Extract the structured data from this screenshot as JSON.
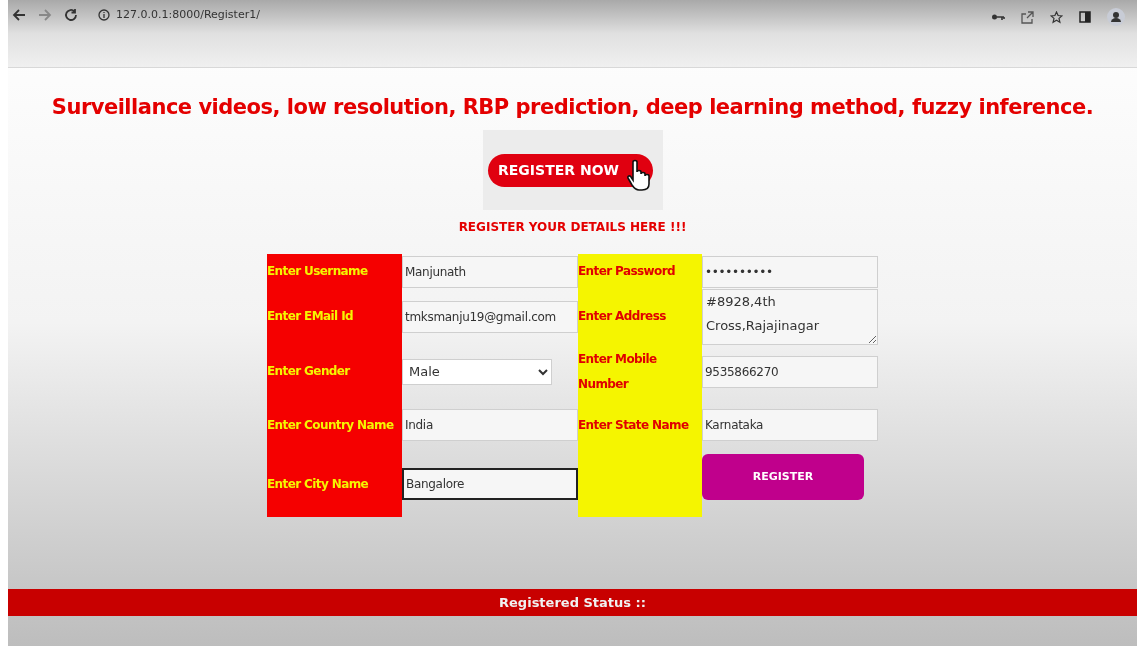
{
  "browser": {
    "url": "127.0.0.1:8000/Register1/"
  },
  "heading": "Surveillance videos, low resolution, RBP prediction, deep learning method, fuzzy inference.",
  "banner": {
    "label": "REGISTER NOW"
  },
  "subtitle": "REGISTER YOUR DETAILS HERE !!!",
  "rows": [
    {
      "left": {
        "label": "Enter Username",
        "field": {
          "kind": "text",
          "value": "Manjunath",
          "focused": false
        }
      },
      "right": {
        "label": "Enter Password",
        "field": {
          "kind": "text",
          "value": "••••••••••",
          "focused": false
        }
      }
    },
    {
      "left": {
        "label": "Enter EMail Id",
        "field": {
          "kind": "text",
          "value": "tmksmanju19@gmail.com",
          "focused": false
        }
      },
      "right": {
        "label": "Enter Address",
        "field": {
          "kind": "textarea",
          "value": "#8928,4th Cross,Rajajinagar",
          "focused": false
        }
      }
    },
    {
      "left": {
        "label": "Enter Gender",
        "field": {
          "kind": "select",
          "value": "Male",
          "focused": false
        }
      },
      "right": {
        "label": "Enter Mobile Number",
        "field": {
          "kind": "text",
          "value": "9535866270",
          "focused": false
        }
      }
    },
    {
      "left": {
        "label": "Enter Country Name",
        "field": {
          "kind": "text",
          "value": "India",
          "focused": false
        }
      },
      "right": {
        "label": "Enter State Name",
        "field": {
          "kind": "text",
          "value": "Karnataka",
          "focused": false
        }
      }
    },
    {
      "left": {
        "label": "Enter City Name",
        "field": {
          "kind": "text",
          "value": "Bangalore",
          "focused": true
        }
      },
      "right": {
        "field": {
          "kind": "button",
          "value": "REGISTER"
        }
      }
    }
  ],
  "status_bar": "Registered Status ::"
}
